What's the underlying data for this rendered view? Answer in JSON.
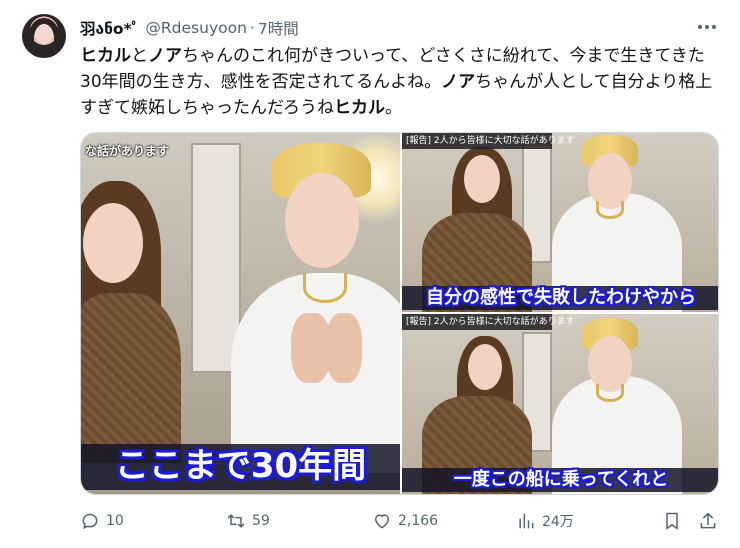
{
  "tweet": {
    "display_name": "羽ანo*ﾟ",
    "handle": "@Rdesuyoon",
    "separator": "·",
    "time": "7時間",
    "text": {
      "s1_bold": "ヒカル",
      "s2": "と",
      "s3_bold": "ノア",
      "s4": "ちゃんのこれ何がきついって、どさくさに紛れて、今まで生きてきた30年間の生き方、感性を否定されてるんよね。",
      "s5_bold": "ノア",
      "s6": "ちゃんが人として自分より格上すぎて嫉妬しちゃったんだろうね",
      "s7_bold": "ヒカル",
      "s8": "。"
    }
  },
  "media": {
    "left": {
      "top_text": "な話があります",
      "caption": "ここまで30年間"
    },
    "top_right": {
      "top_text": "[報告] 2人から皆様に大切な話があります",
      "caption": "自分の感性で失敗したわけやから"
    },
    "bottom_right": {
      "top_text": "[報告] 2人から皆様に大切な話があります",
      "caption": "一度この船に乗ってくれと"
    }
  },
  "actions": {
    "reply_count": "10",
    "retweet_count": "59",
    "like_count": "2,166",
    "views_count": "24万"
  },
  "icons": {
    "reply": "reply-icon",
    "retweet": "retweet-icon",
    "like": "heart-icon",
    "views": "views-icon",
    "bookmark": "bookmark-icon",
    "share": "share-icon",
    "more": "more-icon"
  },
  "colors": {
    "text": "#0f1419",
    "secondary": "#536471",
    "caption_outline": "#1b1bd8",
    "border": "#cfd9de"
  }
}
